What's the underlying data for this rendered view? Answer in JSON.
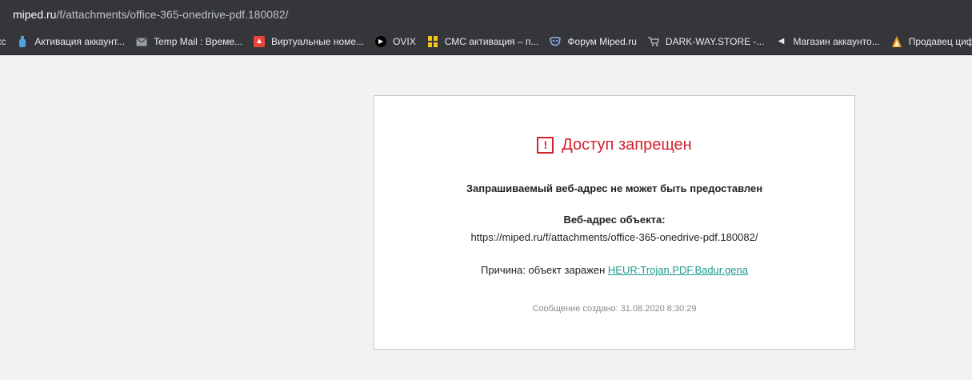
{
  "browser": {
    "address": {
      "host": "miped.ru",
      "path": "/f/attachments/office-365-onedrive-pdf.180082/"
    },
    "bookmarks": [
      {
        "label": "кс",
        "icon": "partial-bookmark-icon",
        "color": "#35363a"
      },
      {
        "label": "Активация аккаунт...",
        "icon": "bottle-icon",
        "color": "#4fa3e0"
      },
      {
        "label": "Temp Mail : Време...",
        "icon": "mail-icon",
        "color": "#9aa0a6"
      },
      {
        "label": "Виртуальные номе...",
        "icon": "red-app-icon",
        "color": "#e8453c"
      },
      {
        "label": "OVIX",
        "icon": "ovix-play-icon",
        "color": "#000000"
      },
      {
        "label": "СМС активация – п...",
        "icon": "sms-grid-icon",
        "color": "#f5c518"
      },
      {
        "label": "Форум Miped.ru",
        "icon": "mask-icon",
        "color": "#8ab4f8"
      },
      {
        "label": "DARK-WAY.STORE -...",
        "icon": "cart-icon",
        "color": "#bdc1c6"
      },
      {
        "label": "Магазин аккаунто...",
        "icon": "speaker-icon",
        "color": "#e8eaed"
      },
      {
        "label": "Продавец цифр",
        "icon": "flame-icon",
        "color": "#f0a020"
      }
    ]
  },
  "block_page": {
    "title": "Доступ запрещен",
    "warning_glyph": "!",
    "subtitle": "Запрашиваемый веб-адрес не может быть предоставлен",
    "url_label": "Веб-адрес объекта:",
    "url_value": "https://miped.ru/f/attachments/office-365-onedrive-pdf.180082/",
    "reason_prefix": "Причина: объект заражен",
    "reason_link": "HEUR:Trojan.PDF.Badur.gena",
    "created": "Сообщение создано: 31.08.2020 8:30:29",
    "accent_color": "#d0232f",
    "link_color": "#1a9a8e"
  }
}
